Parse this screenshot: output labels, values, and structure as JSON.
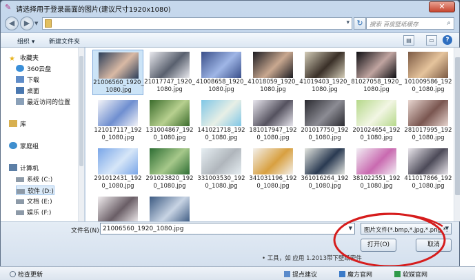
{
  "dialog": {
    "title": "请选择用于登录画面的图片(建议尺寸1920x1080)",
    "close_label": "✕"
  },
  "addressbar": {
    "search_placeholder": "搜索 百度壁纸缓存"
  },
  "toolbar": {
    "organize_label": "组织 ▾",
    "new_folder_label": "新建文件夹"
  },
  "sidebar": {
    "items": [
      {
        "label": "收藏夹",
        "icon": "star-icon",
        "color": "#e8b420"
      },
      {
        "label": "360云盘",
        "icon": "cloud-icon",
        "color": "#3a8fd8"
      },
      {
        "label": "下载",
        "icon": "download-folder-icon",
        "color": "#5f8cc8"
      },
      {
        "label": "桌面",
        "icon": "desktop-icon",
        "color": "#4a78b0"
      },
      {
        "label": "最近访问的位置",
        "icon": "recent-places-icon",
        "color": "#8aa0b8"
      },
      {
        "label": "库",
        "icon": "library-icon",
        "color": "#d8b050"
      },
      {
        "label": "家庭组",
        "icon": "homegroup-icon",
        "color": "#3f8fcf"
      },
      {
        "label": "计算机",
        "icon": "computer-icon",
        "color": "#5c7fa6"
      },
      {
        "label": "系统 (C:)",
        "icon": "drive-icon",
        "color": "#8d9aa8"
      },
      {
        "label": "软件 (D:)",
        "icon": "drive-icon",
        "color": "#8d9aa8"
      },
      {
        "label": "文档 (E:)",
        "icon": "drive-icon",
        "color": "#8d9aa8"
      },
      {
        "label": "娱乐 (F:)",
        "icon": "drive-icon",
        "color": "#8d9aa8"
      }
    ]
  },
  "files": [
    {
      "name": "21006560_1920_1080.jpg",
      "c1": "#2c3f5a",
      "c2": "#d9b9a4",
      "selected": true
    },
    {
      "name": "21017747_1920_1080.jpg",
      "c1": "#e9e9ee",
      "c2": "#59606e"
    },
    {
      "name": "41008658_1920_1080.jpg",
      "c1": "#3a4f8a",
      "c2": "#9fb6e6"
    },
    {
      "name": "41018059_1920_1080.jpg",
      "c1": "#1c1c22",
      "c2": "#c9a890"
    },
    {
      "name": "41019403_1920_1080.jpg",
      "c1": "#d4cdb8",
      "c2": "#3a3028"
    },
    {
      "name": "81027058_1920_1080.jpg",
      "c1": "#0e0e12",
      "c2": "#c0a4a0"
    },
    {
      "name": "101009586_1920_1080.jpg",
      "c1": "#7c5a44",
      "c2": "#e5c49c"
    },
    {
      "name": "121017117_1920_1080.jpg",
      "c1": "#f4f4f8",
      "c2": "#6f8fd0"
    },
    {
      "name": "131004867_1920_1080.jpg",
      "c1": "#3b6c2c",
      "c2": "#b7d08f"
    },
    {
      "name": "141021718_1920_1080.jpg",
      "c1": "#7fc6e6",
      "c2": "#e8efe6"
    },
    {
      "name": "181017947_1920_1080.jpg",
      "c1": "#e8e6ee",
      "c2": "#55525f"
    },
    {
      "name": "201017750_1920_1080.jpg",
      "c1": "#2a2a30",
      "c2": "#8c8c94"
    },
    {
      "name": "201024654_1920_1080.jpg",
      "c1": "#b5d88a",
      "c2": "#f2f6e4"
    },
    {
      "name": "281017995_1920_1080.jpg",
      "c1": "#e8d6d0",
      "c2": "#7a5650"
    },
    {
      "name": "291012431_1920_1080.jpg",
      "c1": "#7aa6e8",
      "c2": "#d6e6f8"
    },
    {
      "name": "291023820_1920_1080.jpg",
      "c1": "#2e6e34",
      "c2": "#a6c88a"
    },
    {
      "name": "331003530_1920_1080.jpg",
      "c1": "#e6eef2",
      "c2": "#b0b6bc"
    },
    {
      "name": "341031196_1920_1080.jpg",
      "c1": "#f3f0ec",
      "c2": "#d8a040"
    },
    {
      "name": "361016264_1920_1080.jpg",
      "c1": "#e4e6e0",
      "c2": "#2a3a52"
    },
    {
      "name": "381022551_1920_1080.jpg",
      "c1": "#f2eef4",
      "c2": "#c96ab0"
    },
    {
      "name": "411017866_1920_1080.jpg",
      "c1": "#eae6ec",
      "c2": "#4c4a58"
    },
    {
      "name": "",
      "c1": "#f0ecee",
      "c2": "#6a5e66"
    },
    {
      "name": "",
      "c1": "#3c5a82",
      "c2": "#c8d4e4"
    }
  ],
  "bottom": {
    "filename_label": "文件名(N):",
    "filename_value": "21006560_1920_1080.jpg",
    "filetype_value": "图片文件(*.bmp,*.jpg,*.png,*.",
    "open_label": "打开(O)",
    "cancel_label": "取消"
  },
  "taskbar": {
    "update_label": "检查更新",
    "suggest_label": "提点建议",
    "official_label": "魔方官网",
    "soft_label": "软媒官网"
  },
  "background_text": "• 工具，如 应用 1.2013带下壁纸密件"
}
